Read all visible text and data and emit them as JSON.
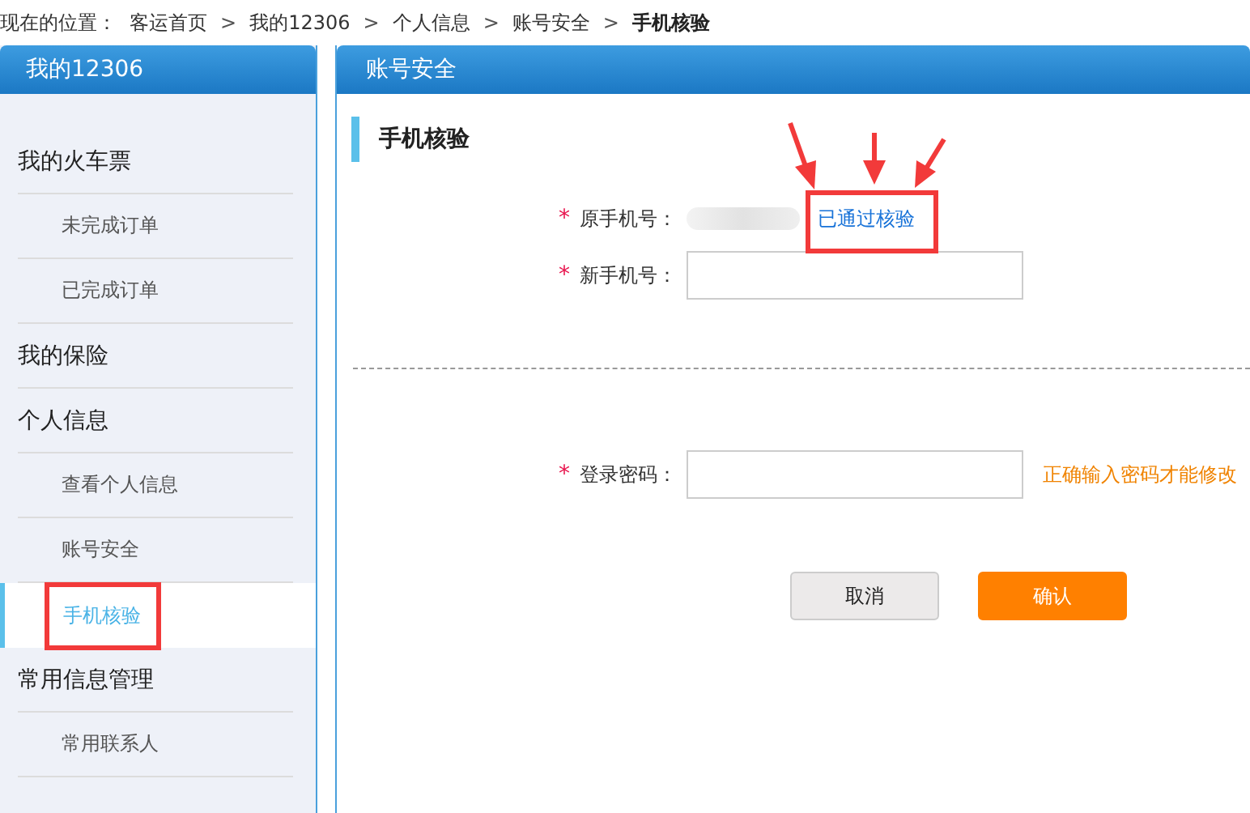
{
  "breadcrumb": {
    "prefix": "现在的位置：",
    "separator": ">",
    "items": [
      {
        "label": "客运首页",
        "current": false
      },
      {
        "label": "我的12306",
        "current": false
      },
      {
        "label": "个人信息",
        "current": false
      },
      {
        "label": "账号安全",
        "current": false
      },
      {
        "label": "手机核验",
        "current": true
      }
    ]
  },
  "sidebar": {
    "title": "我的12306",
    "groups": [
      {
        "label": "我的火车票",
        "children": [
          {
            "label": "未完成订单",
            "selected": false
          },
          {
            "label": "已完成订单",
            "selected": false
          }
        ]
      },
      {
        "label": "我的保险"
      },
      {
        "label": "个人信息",
        "children": [
          {
            "label": "查看个人信息",
            "selected": false
          },
          {
            "label": "账号安全",
            "selected": false
          },
          {
            "label": "手机核验",
            "selected": true
          }
        ]
      },
      {
        "label": "常用信息管理",
        "children": [
          {
            "label": "常用联系人",
            "selected": false
          }
        ]
      }
    ]
  },
  "main": {
    "title": "账号安全",
    "section_title": "手机核验",
    "groups": [
      {
        "fields": [
          {
            "kind": "readonly",
            "mark": "*",
            "label": "原手机号：",
            "status": "已通过核验"
          },
          {
            "kind": "input",
            "mark": "*",
            "label": "新手机号："
          }
        ]
      },
      {
        "fields": [
          {
            "kind": "password",
            "mark": "*",
            "label": "登录密码：",
            "hint": "正确输入密码才能修改"
          }
        ]
      }
    ],
    "buttons": [
      {
        "label": "取消",
        "kind": "secondary"
      },
      {
        "label": "确认",
        "kind": "primary"
      }
    ]
  }
}
